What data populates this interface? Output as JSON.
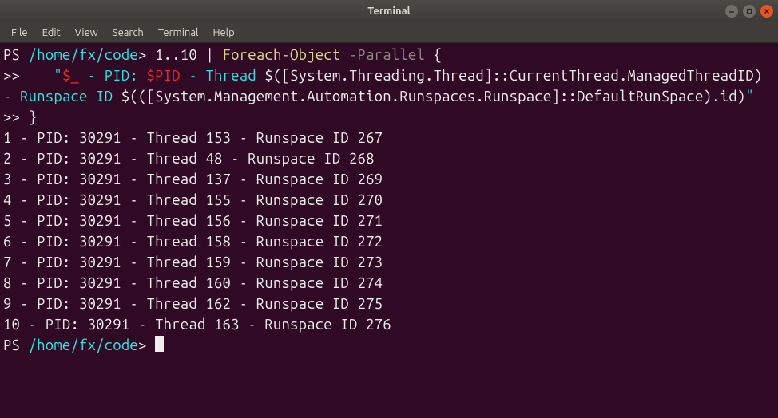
{
  "window": {
    "title": "Terminal"
  },
  "menubar": {
    "items": [
      "File",
      "Edit",
      "View",
      "Search",
      "Terminal",
      "Help"
    ]
  },
  "terminal": {
    "prompt_path": "/home/fx/code",
    "prompt_prefix": "PS ",
    "prompt_suffix": "> ",
    "cmd": {
      "range": "1..10",
      "pipe": " | ",
      "foreach": "Foreach-Object",
      "space": " ",
      "parallel": "-Parallel",
      "brace_open": " {",
      "cont": ">>",
      "indent": "    ",
      "str_open": "\"",
      "s1": "$_",
      "s2": " - PID: ",
      "s3": "$PID",
      "s4": " - Thread ",
      "s5": "$(",
      "s6": "[System.Threading.Thread]",
      "s7": "::CurrentThread.Manag",
      "s7b": "edThreadID",
      "s8": ")",
      "s9": " - Runspace ID ",
      "s10": "$(",
      "s11": "(",
      "s12": "[System.Management.Automation.Runspaces.Runspace]",
      "s13": "::",
      "s13b": "DefaultRunSpace",
      "s14": ")",
      "s15": ".id",
      "s16": ")",
      "str_close": "\"",
      "brace_close": "}"
    },
    "output": [
      "1 - PID: 30291 - Thread 153 - Runspace ID 267",
      "2 - PID: 30291 - Thread 48 - Runspace ID 268",
      "3 - PID: 30291 - Thread 137 - Runspace ID 269",
      "4 - PID: 30291 - Thread 155 - Runspace ID 270",
      "5 - PID: 30291 - Thread 156 - Runspace ID 271",
      "6 - PID: 30291 - Thread 158 - Runspace ID 272",
      "7 - PID: 30291 - Thread 159 - Runspace ID 273",
      "8 - PID: 30291 - Thread 160 - Runspace ID 274",
      "9 - PID: 30291 - Thread 162 - Runspace ID 275",
      "10 - PID: 30291 - Thread 163 - Runspace ID 276"
    ]
  }
}
